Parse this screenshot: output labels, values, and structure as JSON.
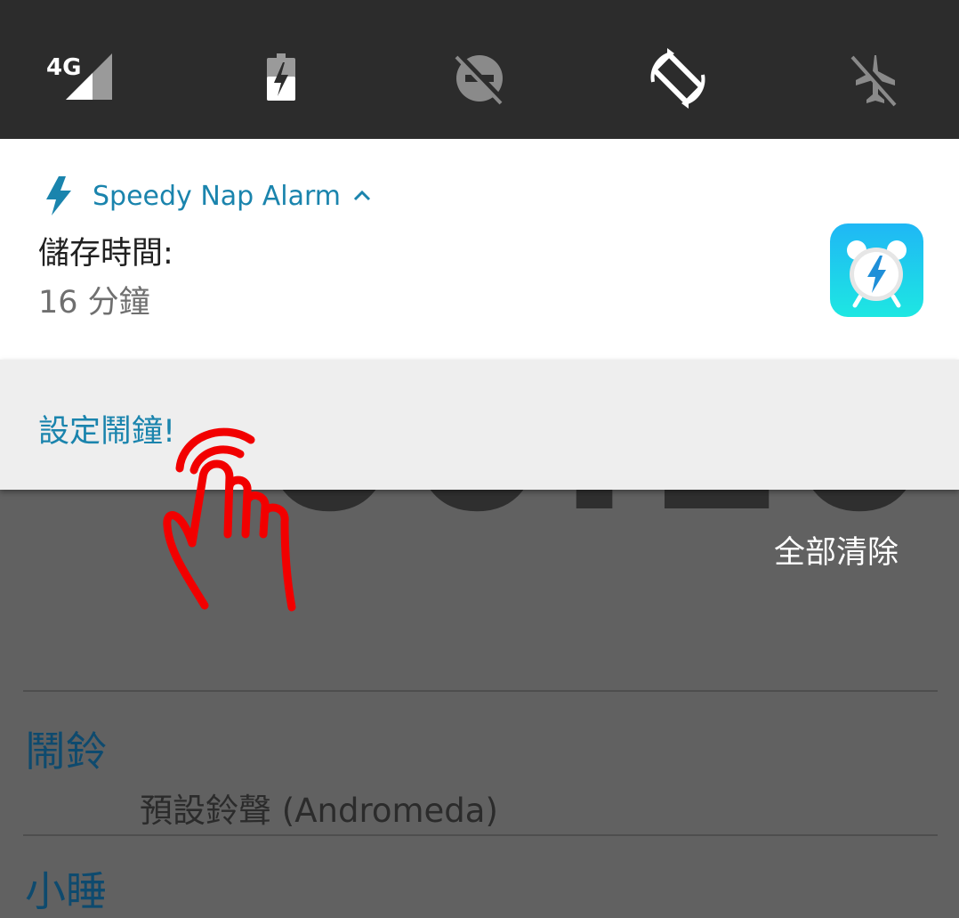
{
  "quick_settings": {
    "tiles": [
      {
        "icon": "signal-4g-icon",
        "label": "4G"
      },
      {
        "icon": "battery-charging-icon"
      },
      {
        "icon": "do-not-disturb-off-icon"
      },
      {
        "icon": "auto-rotate-icon"
      },
      {
        "icon": "airplane-mode-off-icon"
      }
    ]
  },
  "notification": {
    "app_name": "Speedy Nap Alarm",
    "title": "儲存時間:",
    "text": "16 分鐘",
    "action": "設定鬧鐘!",
    "accent_color": "#1a84ad"
  },
  "background_app": {
    "clock_partial": "00:10",
    "clear_all": "全部清除",
    "sections": [
      {
        "title": "鬧鈴",
        "ringtone": "預設鈴聲 (Andromeda)"
      },
      {
        "title": "小睡"
      }
    ]
  }
}
